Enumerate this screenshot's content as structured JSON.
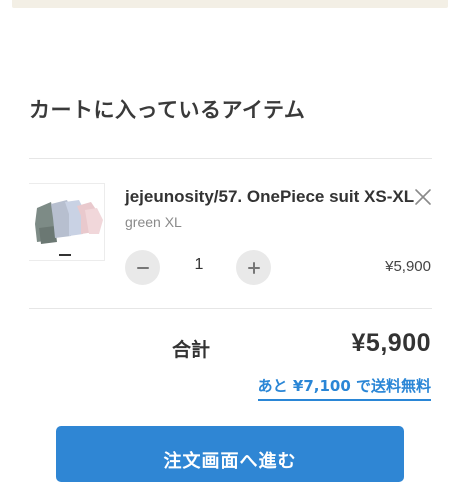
{
  "cart": {
    "title": "カートに入っているアイテム",
    "items": [
      {
        "name": "jejeunosity/57. OnePiece suit XS-XL",
        "variant": "green XL",
        "quantity": "1",
        "price": "¥5,900",
        "remove_icon": "close-icon",
        "decrement_icon": "minus-icon",
        "increment_icon": "plus-icon"
      }
    ],
    "total_label": "合計",
    "total_value": "¥5,900",
    "shipping_note": "あと ¥7,100 で送料無料",
    "checkout_label": "注文画面へ進む"
  },
  "colors": {
    "accent": "#2f86d4",
    "link": "#2a86d6",
    "top_bar": "#f3efe5",
    "quantity_button": "#e9e9e9"
  }
}
